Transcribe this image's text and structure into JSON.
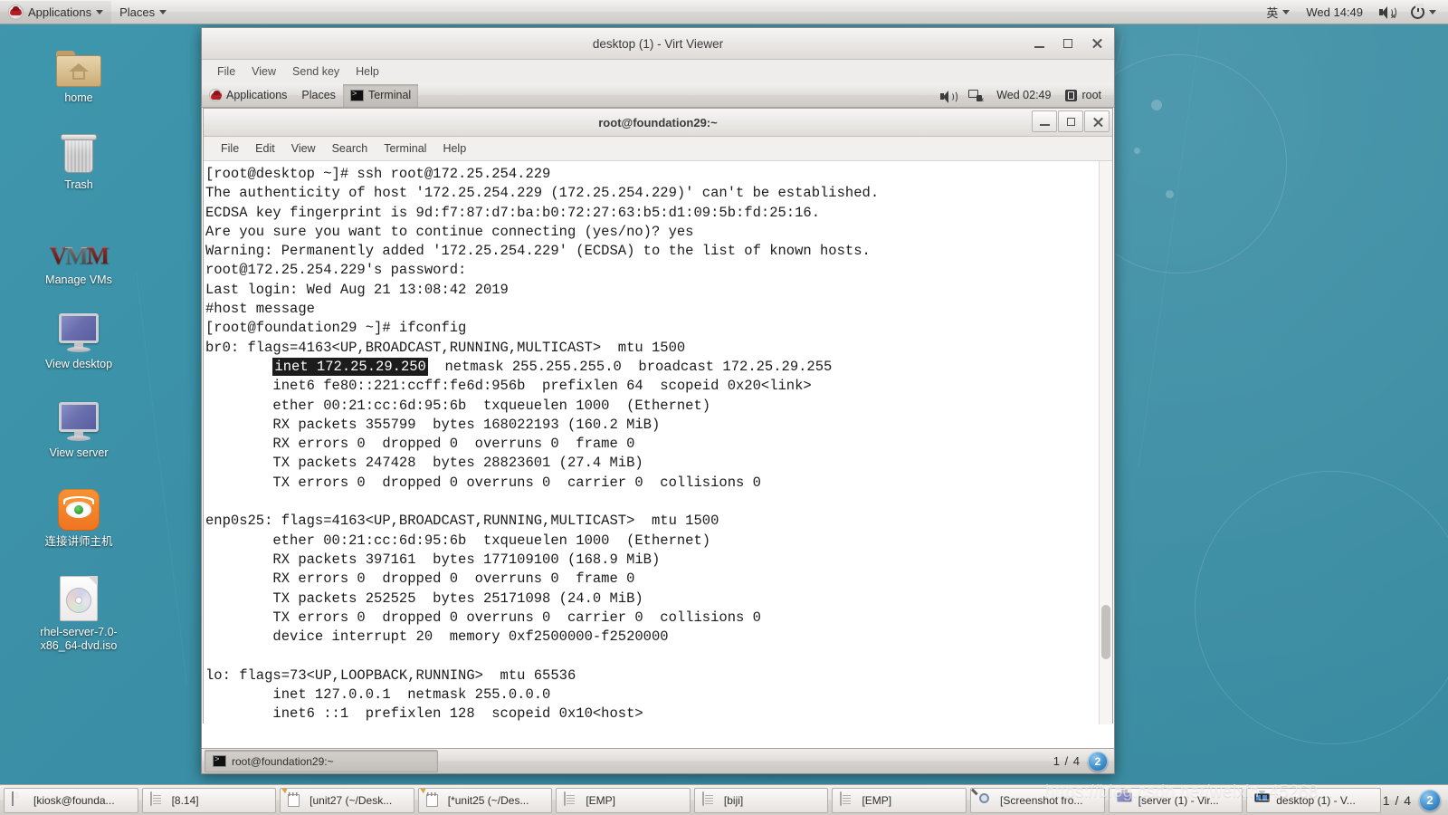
{
  "top_panel": {
    "logo_icon": "redhat-logo-icon",
    "applications": "Applications",
    "places": "Places",
    "input_method": "英",
    "clock": "Wed 14:49",
    "volume_icon": "speaker-muted-icon",
    "power_icon": "power-icon"
  },
  "desktop_icons": [
    {
      "label": "home",
      "icon": "home-folder-icon"
    },
    {
      "label": "Trash",
      "icon": "trash-icon"
    },
    {
      "label": "Manage VMs",
      "icon": "vm-icon"
    },
    {
      "label": "View desktop",
      "icon": "monitor-icon"
    },
    {
      "label": "View server",
      "icon": "monitor-icon"
    },
    {
      "label": "连接讲师主机",
      "icon": "vnc-viewer-icon"
    },
    {
      "label": "rhel-server-7.0-x86_64-dvd.iso",
      "icon": "iso-disc-icon"
    }
  ],
  "virt_viewer": {
    "title": "desktop (1) - Virt Viewer",
    "menus": [
      "File",
      "View",
      "Send key",
      "Help"
    ],
    "window_controls": {
      "minimize": "_",
      "maximize": "□",
      "close": "✕"
    }
  },
  "guest_panel": {
    "applications": "Applications",
    "places": "Places",
    "active_app": "Terminal",
    "volume_icon": "speaker-icon",
    "network_icon": "network-disconnected-icon",
    "clock": "Wed 02:49",
    "user_icon": "user-icon",
    "user": "root"
  },
  "terminal": {
    "title": "root@foundation29:~",
    "menus": [
      "File",
      "Edit",
      "View",
      "Search",
      "Terminal",
      "Help"
    ],
    "lines_before_selection": [
      "[root@desktop ~]# ssh root@172.25.254.229",
      "The authenticity of host '172.25.254.229 (172.25.254.229)' can't be established.",
      "ECDSA key fingerprint is 9d:f7:87:d7:ba:b0:72:27:63:b5:d1:09:5b:fd:25:16.",
      "Are you sure you want to continue connecting (yes/no)? yes",
      "Warning: Permanently added '172.25.254.229' (ECDSA) to the list of known hosts.",
      "root@172.25.254.229's password:",
      "Last login: Wed Aug 21 13:08:42 2019",
      "#host message",
      "[root@foundation29 ~]# ifconfig",
      "br0: flags=4163<UP,BROADCAST,RUNNING,MULTICAST>  mtu 1500"
    ],
    "selection_indent": "        ",
    "selected_text": "inet 172.25.29.250",
    "selection_line_rest": "  netmask 255.255.255.0  broadcast 172.25.29.255",
    "lines_after_selection": [
      "        inet6 fe80::221:ccff:fe6d:956b  prefixlen 64  scopeid 0x20<link>",
      "        ether 00:21:cc:6d:95:6b  txqueuelen 1000  (Ethernet)",
      "        RX packets 355799  bytes 168022193 (160.2 MiB)",
      "        RX errors 0  dropped 0  overruns 0  frame 0",
      "        TX packets 247428  bytes 28823601 (27.4 MiB)",
      "        TX errors 0  dropped 0 overruns 0  carrier 0  collisions 0",
      "",
      "enp0s25: flags=4163<UP,BROADCAST,RUNNING,MULTICAST>  mtu 1500",
      "        ether 00:21:cc:6d:95:6b  txqueuelen 1000  (Ethernet)",
      "        RX packets 397161  bytes 177109100 (168.9 MiB)",
      "        RX errors 0  dropped 0  overruns 0  frame 0",
      "        TX packets 252525  bytes 25171098 (24.0 MiB)",
      "        TX errors 0  dropped 0 overruns 0  carrier 0  collisions 0",
      "        device interrupt 20  memory 0xf2500000-f2520000",
      "",
      "lo: flags=73<UP,LOOPBACK,RUNNING>  mtu 65536",
      "        inet 127.0.0.1  netmask 255.0.0.0",
      "        inet6 ::1  prefixlen 128  scopeid 0x10<host>"
    ]
  },
  "guest_taskbar": {
    "task": "root@foundation29:~",
    "task_icon": "terminal-icon",
    "pager": "1 / 4",
    "workspace_badge": "2"
  },
  "host_taskbar": {
    "tasks": [
      {
        "label": "[kiosk@founda...",
        "icon": "terminal-icon"
      },
      {
        "label": "[8.14]",
        "icon": "document-icon"
      },
      {
        "label": "[unit27 (~/Desk...",
        "icon": "notepad-icon"
      },
      {
        "label": "[*unit25 (~/Des...",
        "icon": "notepad-icon"
      },
      {
        "label": "[EMP]",
        "icon": "document-icon"
      },
      {
        "label": "[biji]",
        "icon": "document-icon"
      },
      {
        "label": "[EMP]",
        "icon": "document-icon"
      },
      {
        "label": "[Screenshot fro...",
        "icon": "screenshot-icon"
      },
      {
        "label": "[server (1) - Vir...",
        "icon": "monitor-icon"
      },
      {
        "label": "desktop (1) - V...",
        "icon": "virt-viewer-icon"
      }
    ],
    "pager": "1 / 4",
    "workspace_badge": "2"
  },
  "watermark": {
    "text": "https://blog.csdn.net/weixin_45268..."
  }
}
